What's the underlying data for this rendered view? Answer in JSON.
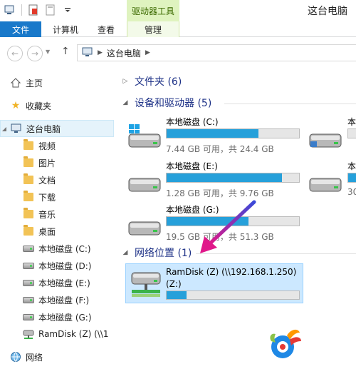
{
  "window": {
    "title": "这台电脑",
    "context_tab_title": "驱动器工具"
  },
  "ribbon": {
    "tabs": [
      "文件",
      "计算机",
      "查看",
      "管理"
    ]
  },
  "address": {
    "breadcrumb": "这台电脑"
  },
  "navpane": {
    "items": [
      {
        "label": "主页",
        "icon": "home-icon"
      },
      {
        "label": "收藏夹",
        "icon": "star-icon"
      },
      {
        "label": "这台电脑",
        "icon": "computer-icon"
      },
      {
        "label": "视频",
        "icon": "folder-icon"
      },
      {
        "label": "图片",
        "icon": "folder-icon"
      },
      {
        "label": "文档",
        "icon": "folder-icon"
      },
      {
        "label": "下载",
        "icon": "folder-icon"
      },
      {
        "label": "音乐",
        "icon": "folder-icon"
      },
      {
        "label": "桌面",
        "icon": "folder-icon"
      },
      {
        "label": "本地磁盘 (C:)",
        "icon": "drive-icon"
      },
      {
        "label": "本地磁盘 (D:)",
        "icon": "drive-icon"
      },
      {
        "label": "本地磁盘 (E:)",
        "icon": "drive-icon"
      },
      {
        "label": "本地磁盘 (F:)",
        "icon": "drive-icon"
      },
      {
        "label": "本地磁盘 (G:)",
        "icon": "drive-icon"
      },
      {
        "label": "RamDisk (Z) (\\\\1",
        "icon": "network-drive-icon"
      },
      {
        "label": "网络",
        "icon": "network-icon"
      }
    ]
  },
  "content": {
    "groups": {
      "folders": "文件夹 (6)",
      "devices": "设备和驱动器 (5)",
      "network": "网络位置 (1)"
    },
    "drives": [
      {
        "name": "本地磁盘 (C:)",
        "info": "7.44 GB 可用，共 24.4 GB",
        "used_fraction": 0.695
      },
      {
        "name": "本地磁盘 (E:)",
        "info": "1.28 GB 可用，共 9.76 GB",
        "used_fraction": 0.869
      },
      {
        "name": "本地磁盘 (G:)",
        "info": "19.5 GB 可用，共 51.3 GB",
        "used_fraction": 0.62
      }
    ],
    "partial_drives": [
      {
        "name": "本"
      },
      {
        "name": "本",
        "info": "30"
      }
    ],
    "ramdisk": {
      "name": "RamDisk (Z) (\\\\192.168.1.250)",
      "letter": "(Z:)",
      "used_fraction": 0.15
    }
  },
  "colors": {
    "accent": "#1979ca",
    "bar_fill": "#26a0da",
    "group_header": "#1e3287",
    "selection": "#cce8ff",
    "arrow": "#e0188a"
  }
}
